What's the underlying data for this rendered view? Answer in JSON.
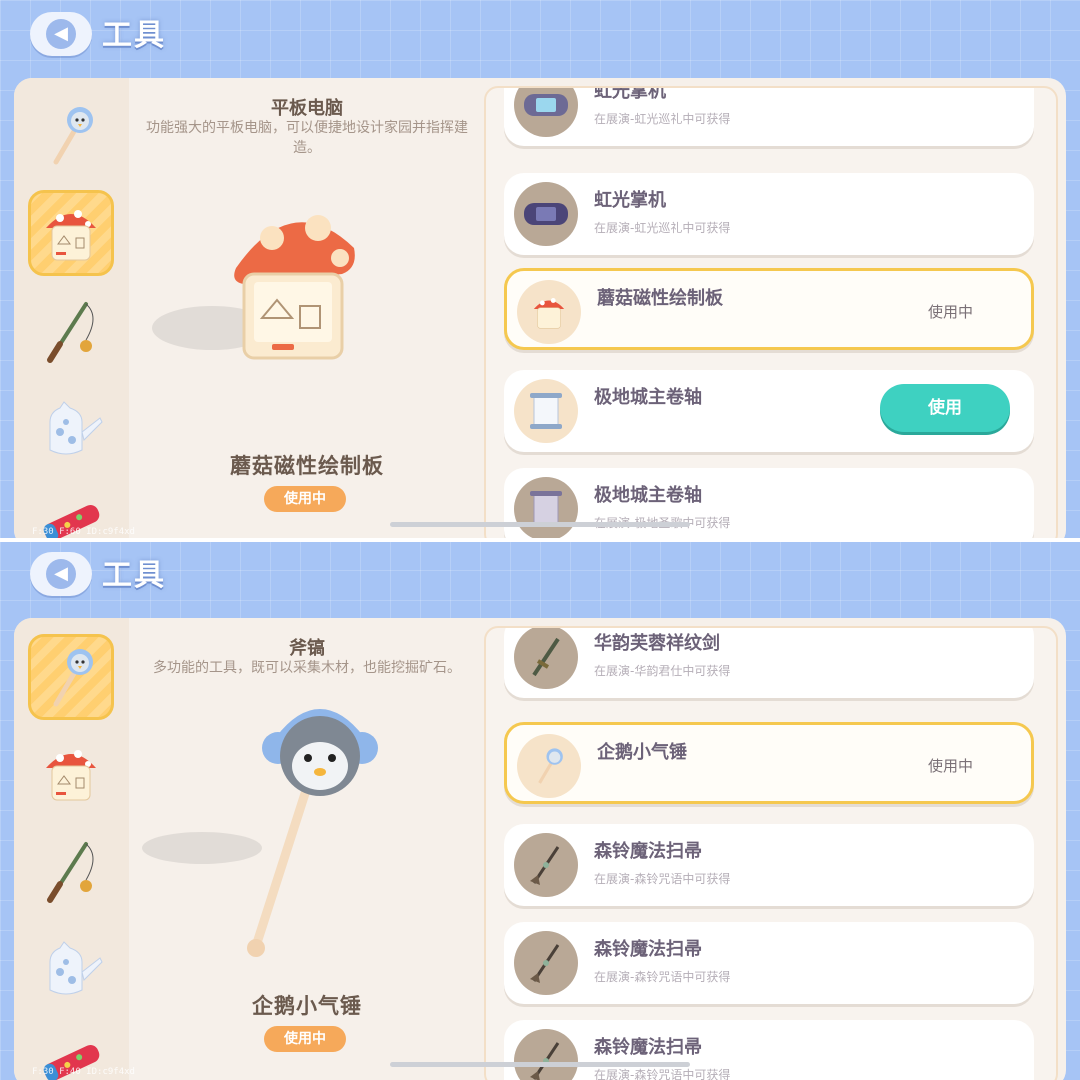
{
  "colors": {
    "accent": "#3ed1c1",
    "selected_border": "#f5c84f",
    "badge": "#f6a95a",
    "background": "#a6c4f5"
  },
  "panels": [
    {
      "header": {
        "title": "工具",
        "back_icon": "chevron-left-icon"
      },
      "sidebar": [
        {
          "icon": "penguin-hammer-icon",
          "active": false
        },
        {
          "icon": "mushroom-board-icon",
          "active": true
        },
        {
          "icon": "fishing-rod-icon",
          "active": false
        },
        {
          "icon": "watering-can-icon",
          "active": false
        },
        {
          "icon": "telescope-icon",
          "active": false
        }
      ],
      "detail": {
        "name": "平板电脑",
        "desc": "功能强大的平板电脑，可以便捷地设计家园并指挥建造。",
        "item_name": "蘑菇磁性绘制板",
        "badge": "使用中"
      },
      "list": [
        {
          "name": "虹光掌机",
          "sub": "在展演-虹光巡礼中可获得",
          "icon": "handheld-console-icon",
          "state": "locked"
        },
        {
          "name": "虹光掌机",
          "sub": "在展演-虹光巡礼中可获得",
          "icon": "handheld-console-icon",
          "state": "locked"
        },
        {
          "name": "蘑菇磁性绘制板",
          "sub": "",
          "icon": "mushroom-board-icon",
          "state": "using",
          "state_label": "使用中"
        },
        {
          "name": "极地城主卷轴",
          "sub": "",
          "icon": "scroll-icon",
          "state": "owned",
          "state_label": "使用"
        },
        {
          "name": "极地城主卷轴",
          "sub": "在展演-极地圣歌中可获得",
          "icon": "scroll-icon",
          "state": "locked"
        }
      ],
      "debug": "F:30  F:60  ID:c9f4xd"
    },
    {
      "header": {
        "title": "工具",
        "back_icon": "chevron-left-icon"
      },
      "sidebar": [
        {
          "icon": "penguin-hammer-icon",
          "active": true
        },
        {
          "icon": "mushroom-board-icon",
          "active": false
        },
        {
          "icon": "fishing-rod-icon",
          "active": false
        },
        {
          "icon": "watering-can-icon",
          "active": false
        },
        {
          "icon": "telescope-icon",
          "active": false
        }
      ],
      "detail": {
        "name": "斧镐",
        "desc": "多功能的工具，既可以采集木材，也能挖掘矿石。",
        "item_name": "企鹅小气锤",
        "badge": "使用中"
      },
      "list": [
        {
          "name": "华韵芙蓉祥纹剑",
          "sub": "在展演-华韵君仕中可获得",
          "icon": "sword-icon",
          "state": "locked"
        },
        {
          "name": "企鹅小气锤",
          "sub": "",
          "icon": "penguin-hammer-icon",
          "state": "using",
          "state_label": "使用中"
        },
        {
          "name": "森铃魔法扫帚",
          "sub": "在展演-森铃咒语中可获得",
          "icon": "broom-icon",
          "state": "locked"
        },
        {
          "name": "森铃魔法扫帚",
          "sub": "在展演-森铃咒语中可获得",
          "icon": "broom-icon",
          "state": "locked"
        },
        {
          "name": "森铃魔法扫帚",
          "sub": "在展演-森铃咒语中可获得",
          "icon": "broom-icon",
          "state": "locked"
        }
      ],
      "debug": "F:30  F:40  ID:c9f4xd"
    }
  ]
}
